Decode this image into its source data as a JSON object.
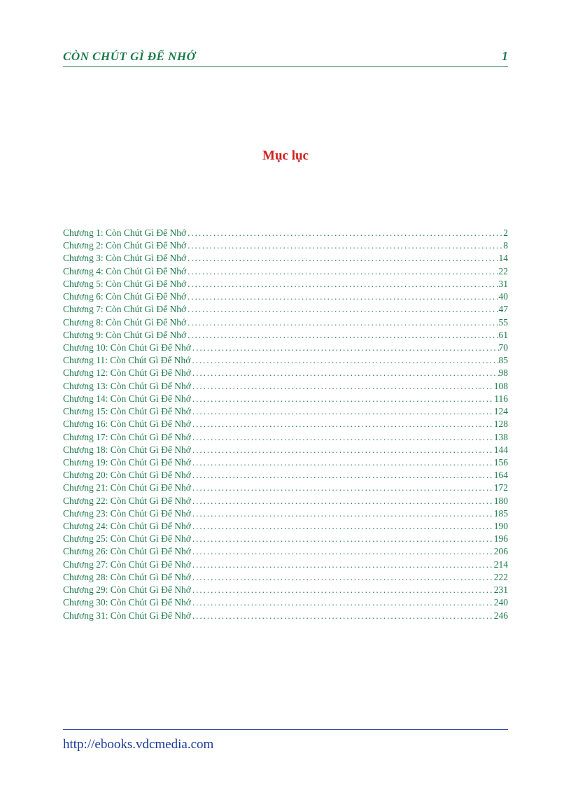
{
  "header": {
    "title": "CÒN CHÚT GÌ ĐỂ NHỚ",
    "page_number": "1"
  },
  "toc": {
    "heading": "Mục lục",
    "entries": [
      {
        "label": "Chương 1: Còn Chút Gì Để Nhớ",
        "page": "2"
      },
      {
        "label": "Chương 2: Còn Chút Gì Để Nhớ",
        "page": "8"
      },
      {
        "label": "Chương 3: Còn Chút Gì Để Nhớ",
        "page": "14"
      },
      {
        "label": "Chương 4: Còn Chút Gì Để Nhớ",
        "page": "22"
      },
      {
        "label": "Chương 5: Còn Chút Gì Để Nhớ",
        "page": "31"
      },
      {
        "label": "Chương 6: Còn Chút Gì Để Nhớ",
        "page": "40"
      },
      {
        "label": "Chương 7: Còn Chút Gì Để Nhớ",
        "page": "47"
      },
      {
        "label": "Chương 8: Còn Chút Gì Để Nhớ",
        "page": "55"
      },
      {
        "label": "Chương 9: Còn Chút Gì Để Nhớ",
        "page": "61"
      },
      {
        "label": "Chương 10: Còn Chút Gì Để Nhớ",
        "page": "70"
      },
      {
        "label": "Chương 11: Còn Chút Gì Để Nhớ",
        "page": "85"
      },
      {
        "label": "Chương 12: Còn Chút Gì Để Nhớ",
        "page": "98"
      },
      {
        "label": "Chương 13: Còn Chút Gì Để Nhớ",
        "page": "108"
      },
      {
        "label": "Chương 14: Còn Chút Gì Để Nhớ",
        "page": "116"
      },
      {
        "label": "Chương 15: Còn Chút Gì Để Nhớ",
        "page": "124"
      },
      {
        "label": "Chương 16: Còn Chút Gì Để Nhớ",
        "page": "128"
      },
      {
        "label": "Chương 17: Còn Chút Gì Để Nhớ",
        "page": "138"
      },
      {
        "label": "Chương 18: Còn Chút Gì Để Nhớ",
        "page": "144"
      },
      {
        "label": "Chương 19: Còn Chút Gì Để Nhớ",
        "page": "156"
      },
      {
        "label": "Chương 20: Còn Chút Gì Để Nhớ",
        "page": "164"
      },
      {
        "label": "Chương 21: Còn Chút Gì Để Nhớ",
        "page": "172"
      },
      {
        "label": "Chương 22: Còn Chút Gì Để Nhớ",
        "page": "180"
      },
      {
        "label": "Chương 23: Còn Chút Gì Để Nhớ",
        "page": "185"
      },
      {
        "label": "Chương 24: Còn Chút Gì Để Nhớ",
        "page": "190"
      },
      {
        "label": "Chương 25: Còn Chút Gì Để Nhớ",
        "page": "196"
      },
      {
        "label": "Chương 26: Còn Chút Gì Để Nhớ",
        "page": "206"
      },
      {
        "label": "Chương 27: Còn Chút Gì Để Nhớ",
        "page": "214"
      },
      {
        "label": "Chương 28: Còn Chút Gì Để Nhớ",
        "page": "222"
      },
      {
        "label": "Chương 29: Còn Chút Gì Để Nhớ",
        "page": "231"
      },
      {
        "label": "Chương 30: Còn Chút Gì Để Nhớ",
        "page": "240"
      },
      {
        "label": "Chương 31: Còn Chút Gì Để Nhớ",
        "page": "246"
      }
    ]
  },
  "footer": {
    "url": "http://ebooks.vdcmedia.com"
  }
}
